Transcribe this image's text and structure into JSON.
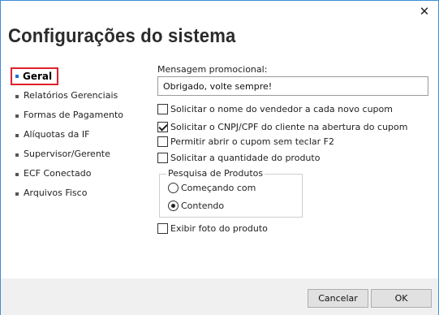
{
  "window": {
    "title": "Configurações do sistema",
    "close_glyph": "✕"
  },
  "sidebar": {
    "items": [
      {
        "label": "Geral",
        "active": true
      },
      {
        "label": "Relatórios Gerenciais"
      },
      {
        "label": "Formas de Pagamento"
      },
      {
        "label": "Alíquotas da IF"
      },
      {
        "label": "Supervisor/Gerente"
      },
      {
        "label": "ECF Conectado"
      },
      {
        "label": "Arquivos Fisco"
      }
    ]
  },
  "main": {
    "promo_label": "Mensagem promocional:",
    "promo_value": "Obrigado, volte sempre!",
    "checks": [
      {
        "label": "Solicitar o nome do vendedor a cada novo cupom",
        "checked": false
      },
      {
        "label": "Solicitar o CNPJ/CPF do cliente na abertura do cupom",
        "checked": true
      },
      {
        "label": "Permitir abrir o cupom sem teclar F2",
        "checked": false
      },
      {
        "label": "Solicitar a quantidade do produto",
        "checked": false
      }
    ],
    "search_group": {
      "label": "Pesquisa de Produtos",
      "options": [
        {
          "label": "Começando com",
          "selected": false
        },
        {
          "label": "Contendo",
          "selected": true
        }
      ]
    },
    "photo_check": {
      "label": "Exibir foto do produto",
      "checked": false
    }
  },
  "footer": {
    "cancel_label": "Cancelar",
    "ok_label": "OK"
  },
  "colors": {
    "active_border": "#e0202a",
    "active_bullet": "#1f6fd0",
    "window_border": "#3c8fd8",
    "footer_bg": "#f0f0f0"
  }
}
